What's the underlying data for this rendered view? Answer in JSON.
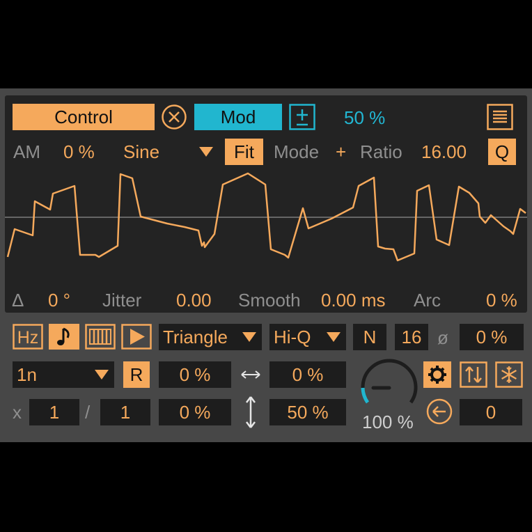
{
  "colors": {
    "accent": "#f5a95c",
    "mod": "#21b6cf",
    "panel": "#474747",
    "screen": "#232323",
    "field": "#1d1d1d"
  },
  "header": {
    "control_label": "Control",
    "mod_label": "Mod",
    "mod_amount": "50 %"
  },
  "row2": {
    "am_label": "AM",
    "am_value": "0 %",
    "wave": "Sine",
    "fit_label": "Fit",
    "mode_label": "Mode",
    "mode_value": "+",
    "ratio_label": "Ratio",
    "ratio_value": "16.00",
    "q_label": "Q"
  },
  "bottom_params": {
    "delta_label": "Δ",
    "delta_value": "0 °",
    "jitter_label": "Jitter",
    "jitter_value": "0.00",
    "smooth_label": "Smooth",
    "smooth_value": "0.00 ms",
    "arc_label": "Arc",
    "arc_value": "0 %"
  },
  "controls": {
    "hz_label": "Hz",
    "shape": "Triangle",
    "quality": "Hi-Q",
    "n_label": "N",
    "n_value": "16",
    "phase_label": "ø",
    "phase_value": "0 %",
    "rate": "1n",
    "r_label": "R",
    "offset1": "0 %",
    "offset2": "0 %",
    "offset3": "0 %",
    "depth": "50 %",
    "x_label": "x",
    "mult": "1",
    "slash": "/",
    "div": "1",
    "knob_value": "100 %",
    "knob_level": 1.0,
    "reset_value": "0"
  },
  "icons": [
    "close-icon",
    "plus-minus-icon",
    "menu-icon",
    "hz-icon",
    "note-icon",
    "keyboard-icon",
    "play-icon",
    "dropdown-arrow-icon",
    "horizontal-arrow-icon",
    "vertical-arrow-icon",
    "gear-icon",
    "swap-icon",
    "snowflake-icon",
    "back-arrow-icon"
  ]
}
